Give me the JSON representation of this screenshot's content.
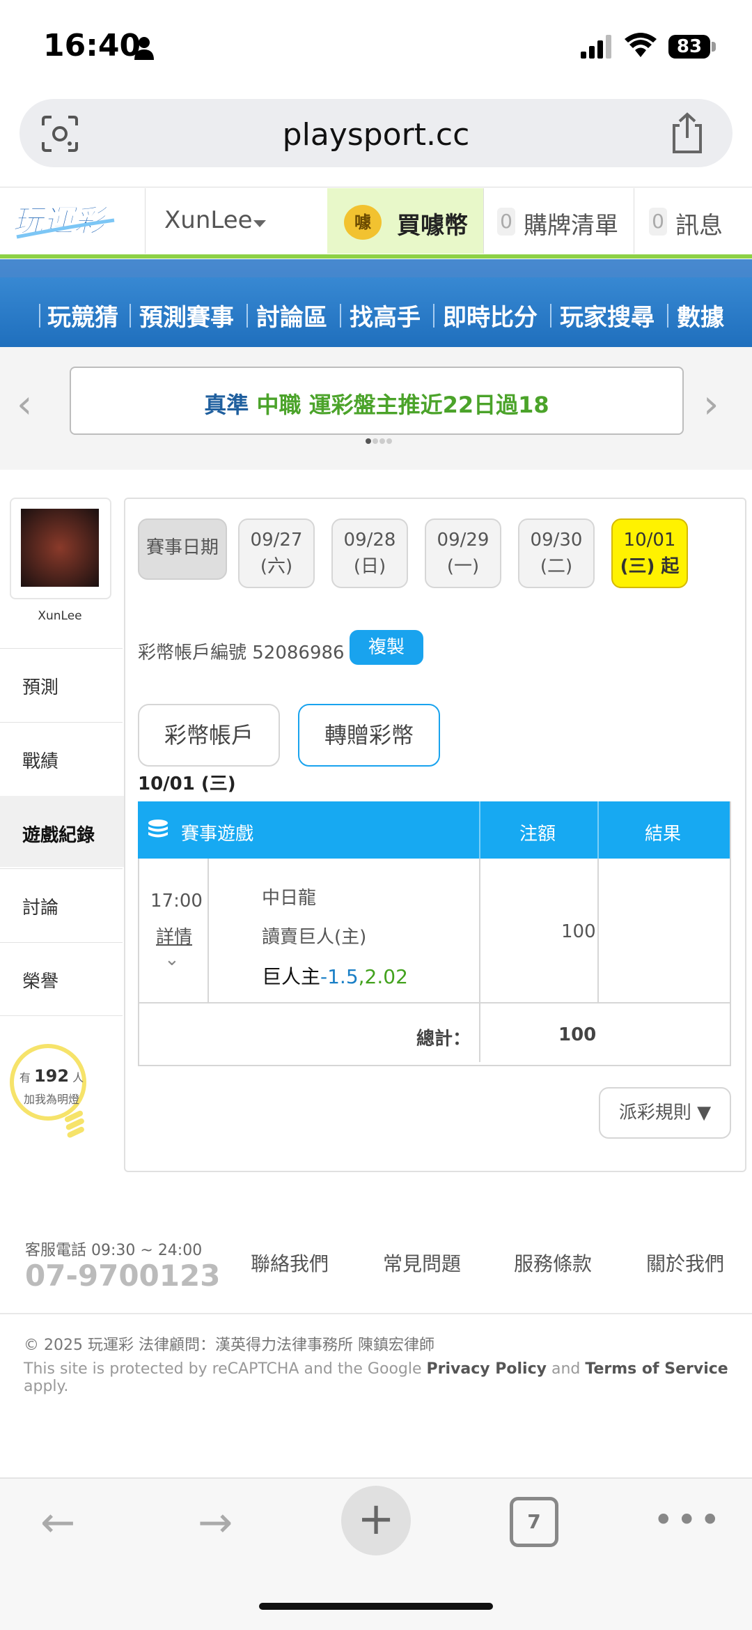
{
  "status_bar": {
    "time": "16:40",
    "battery": "83"
  },
  "browser": {
    "url": "playsport.cc",
    "tab_count": "7"
  },
  "header": {
    "logo_text": "玩運彩",
    "username": "XunLee",
    "buy_label": "買噱幣",
    "coin_char": "噱",
    "cart_count": "0",
    "cart_label": "購牌清單",
    "msg_count": "0",
    "msg_label": "訊息"
  },
  "nav": [
    "玩競猜",
    "預測賽事",
    "討論區",
    "找高手",
    "即時比分",
    "玩家搜尋",
    "數據"
  ],
  "banner": {
    "part1": "真準",
    "part2": "中職",
    "part3": "運彩盤主推近22日過18"
  },
  "sidebar": {
    "username": "XunLee",
    "items": [
      "預測",
      "戰績",
      "遊戲紀錄",
      "討論",
      "榮譽"
    ],
    "bulb_prefix": "有",
    "bulb_count": "192",
    "bulb_suffix": "人",
    "bulb_text": "加我為明燈"
  },
  "dates": {
    "label": "賽事日期",
    "items": [
      {
        "date": "09/27",
        "day": "(六)"
      },
      {
        "date": "09/28",
        "day": "(日)"
      },
      {
        "date": "09/29",
        "day": "(一)"
      },
      {
        "date": "09/30",
        "day": "(二)"
      },
      {
        "date": "10/01",
        "day": "(三) 起"
      }
    ]
  },
  "account": {
    "label": "彩幣帳戶編號 52086986",
    "copy_label": "複製"
  },
  "tabs": {
    "account": "彩幣帳戶",
    "gift": "轉贈彩幣"
  },
  "selected_date": "10/01 (三)",
  "table": {
    "headers": {
      "game": "賽事遊戲",
      "stake": "注額",
      "result": "結果"
    },
    "row": {
      "time": "17:00",
      "detail": "詳情",
      "away": "中日龍",
      "home": "讀賣巨人(主)",
      "pick": "巨人主",
      "line": "-1.5",
      "odds": ",2.02",
      "amount": "100",
      "result": ""
    },
    "total_label": "總計：",
    "total_value": "100"
  },
  "payout_rules": "派彩規則 ▼",
  "footer": {
    "cs_label": "客服電話 09:30 ~ 24:00",
    "phone": "07-9700123",
    "links": [
      "聯絡我們",
      "常見問題",
      "服務條款",
      "關於我們"
    ],
    "copyright": "© 2025 玩運彩 法律顧問：漢英得力法律事務所 陳鎮宏律師",
    "recaptcha_pre": "This site is protected by reCAPTCHA and the Google ",
    "privacy": "Privacy Policy",
    "and": " and ",
    "terms": "Terms of Service",
    "apply": " apply."
  },
  "colors": {
    "accent_blue": "#17a9f2",
    "highlight_yellow": "#fff200",
    "brand_green": "#8dd146",
    "nav_blue": "#1f6fbd"
  }
}
